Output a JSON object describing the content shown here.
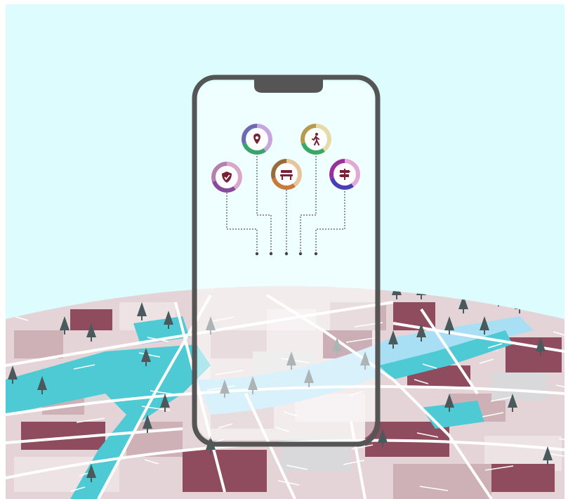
{
  "scene": {
    "description_text": "",
    "colors": {
      "sky": "#dcfcfd",
      "map_base": "#e4d4d7",
      "map_block_light": "#ede3e5",
      "map_block_mid": "#cdb1b7",
      "map_block_dark": "#8e4c5e",
      "map_gray": "#d9d9db",
      "water": "#4ecad4",
      "water_light": "#a9dff5",
      "road": "#ffffff",
      "tree": "#4a5a5c",
      "phone_frame": "#555555",
      "phone_screen_tint": "#ffffff"
    }
  },
  "phone": {
    "icons": [
      {
        "name": "location-pin-icon",
        "ring": [
          "#c7a6e0",
          "#3aa36b",
          "#6d6ab0"
        ],
        "glyph_color": "#7a2036"
      },
      {
        "name": "pedestrian-icon",
        "ring": [
          "#e7d9a8",
          "#39a862",
          "#b69a4e"
        ],
        "glyph_color": "#7a2036"
      },
      {
        "name": "shield-check-icon",
        "ring": [
          "#d9a8c9",
          "#8a4a9a",
          "#b77fb0"
        ],
        "glyph_color": "#7a2036"
      },
      {
        "name": "bench-icon",
        "ring": [
          "#e8c49a",
          "#c87a38",
          "#9a6a3a"
        ],
        "glyph_color": "#7a2036"
      },
      {
        "name": "signpost-icon",
        "ring": [
          "#e3a9d6",
          "#4a3db8",
          "#9b2f9b"
        ],
        "glyph_color": "#7a2036"
      }
    ]
  }
}
